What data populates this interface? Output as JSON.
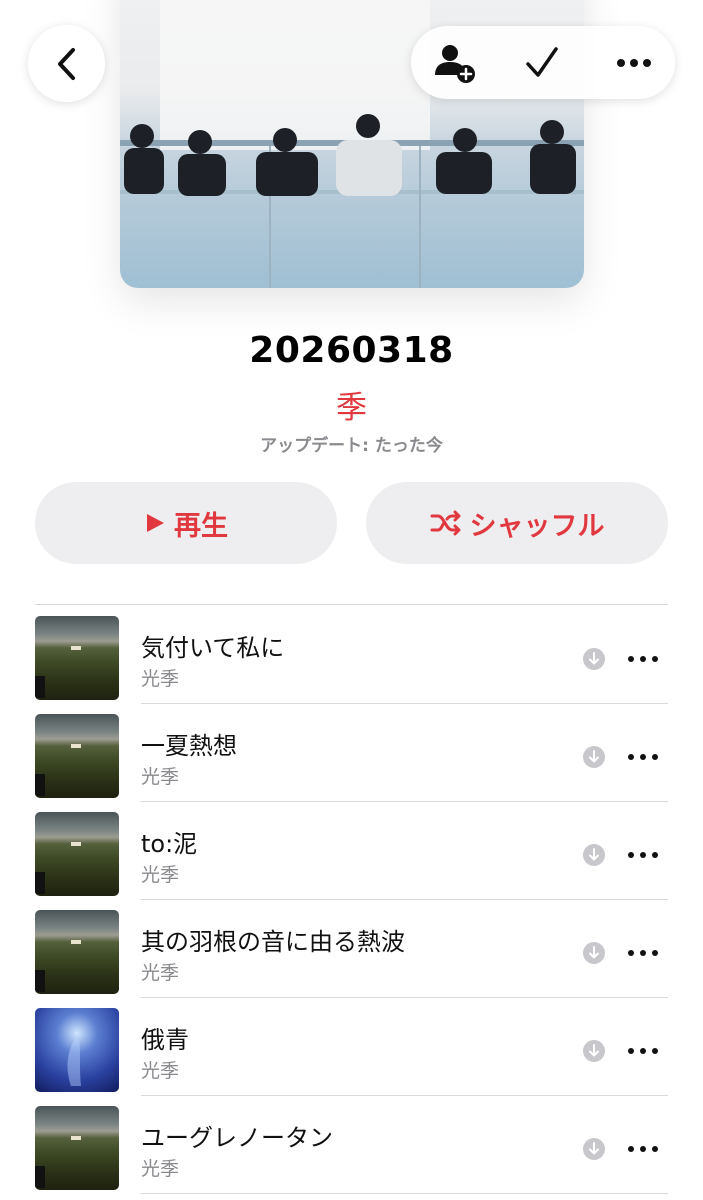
{
  "playlist": {
    "title": "20260318",
    "curator": "季",
    "updated": "アップデート: たった今"
  },
  "header": {
    "back_icon": "chevron-left-icon",
    "add_person_icon": "person-add-icon",
    "check_icon": "checkmark-icon",
    "more_icon": "ellipsis-icon"
  },
  "actions": {
    "play_label": "再生",
    "shuffle_label": "シャッフル"
  },
  "colors": {
    "accent": "#e0383e",
    "secondary_text": "#8a8a8e",
    "button_bg": "#eeeef0"
  },
  "tracks": [
    {
      "title": "気付いて私に",
      "artist": "光季",
      "artwork": "landscape"
    },
    {
      "title": "一夏熱想",
      "artist": "光季",
      "artwork": "landscape"
    },
    {
      "title": "to:泥",
      "artist": "光季",
      "artwork": "landscape"
    },
    {
      "title": "其の羽根の音に由る熱波",
      "artist": "光季",
      "artwork": "landscape"
    },
    {
      "title": "俄青",
      "artist": "光季",
      "artwork": "blue"
    },
    {
      "title": "ユーグレノータン",
      "artist": "光季",
      "artwork": "landscape"
    }
  ]
}
